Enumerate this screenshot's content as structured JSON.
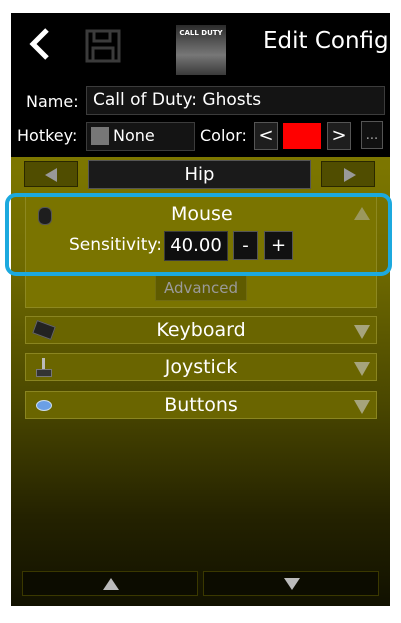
{
  "header": {
    "title": "Edit Config",
    "back_icon": "back-chevron-icon",
    "save_icon": "floppy-disk-icon",
    "game_icon": "game-cover-icon",
    "game_cover_text": "CALL DUTY"
  },
  "name_row": {
    "label": "Name:",
    "value": "Call of Duty: Ghosts"
  },
  "hotkey_row": {
    "label": "Hotkey:",
    "value": "None",
    "color_label": "Color:",
    "prev": "<",
    "next": ">",
    "more": "...",
    "color": "#ff0000"
  },
  "mode": {
    "label": "Hip",
    "prev_icon": "arrow-left-icon",
    "next_icon": "arrow-right-icon"
  },
  "mouse_section": {
    "label": "Mouse",
    "sensitivity_label": "Sensitivity:",
    "sensitivity_value": "40.00",
    "minus": "-",
    "plus": "+",
    "advanced": "Advanced"
  },
  "sections": [
    {
      "label": "Keyboard",
      "icon": "keyboard-icon"
    },
    {
      "label": "Joystick",
      "icon": "joystick-icon"
    },
    {
      "label": "Buttons",
      "icon": "buttons-icon"
    }
  ],
  "colors": {
    "highlight": "#1ca9de",
    "panel": "#7d7700"
  }
}
